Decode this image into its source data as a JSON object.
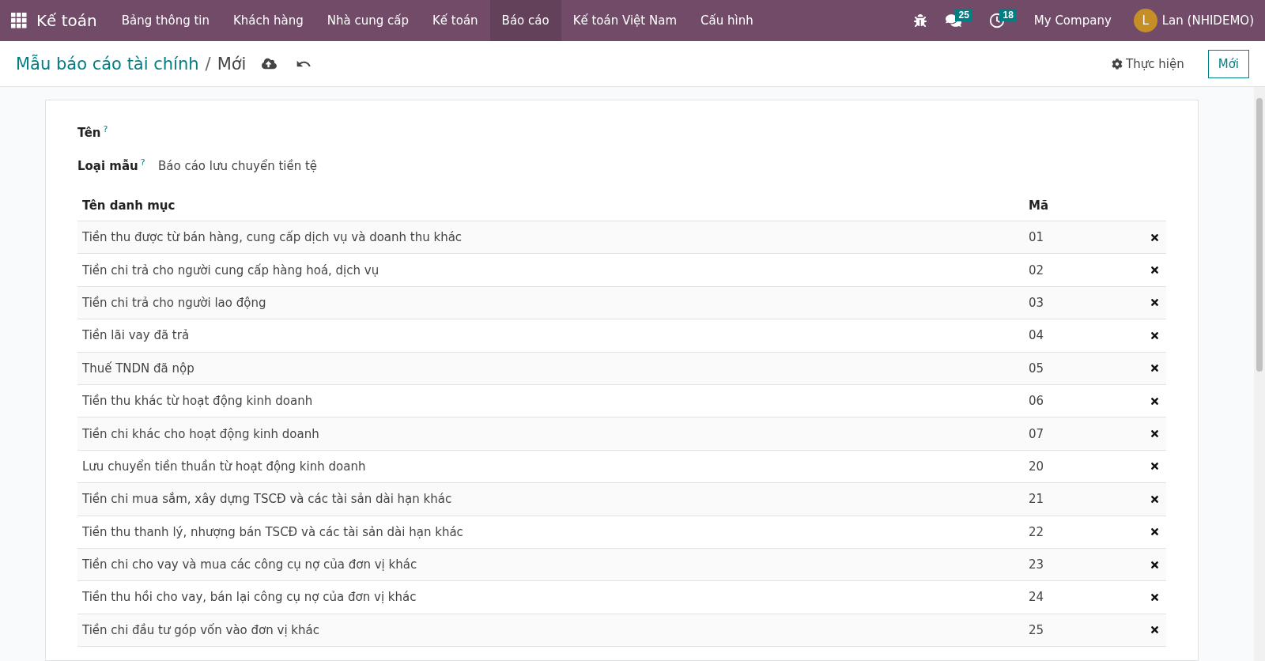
{
  "navbar": {
    "app_name": "Kế toán",
    "menu": [
      {
        "label": "Bảng thông tin",
        "selected": false
      },
      {
        "label": "Khách hàng",
        "selected": false
      },
      {
        "label": "Nhà cung cấp",
        "selected": false
      },
      {
        "label": "Kế toán",
        "selected": false
      },
      {
        "label": "Báo cáo",
        "selected": true
      },
      {
        "label": "Kế toán Việt Nam",
        "selected": false
      },
      {
        "label": "Cấu hình",
        "selected": false
      }
    ],
    "messages_count": "25",
    "activities_count": "18",
    "company": "My Company",
    "avatar_letter": "L",
    "user": "Lan (NHIDEMO)"
  },
  "control_panel": {
    "breadcrumb_parent": "Mẫu báo cáo tài chính",
    "breadcrumb_separator": "/",
    "breadcrumb_current": "Mới",
    "action_button": "Thực hiện",
    "new_button": "Mới"
  },
  "form": {
    "fields": [
      {
        "label": "Tên",
        "help": "?"
      },
      {
        "label": "Loại mẫu",
        "help": "?",
        "value": "Báo cáo lưu chuyển tiền tệ"
      }
    ],
    "table": {
      "columns": [
        "Tên danh mục",
        "Mã"
      ],
      "rows": [
        {
          "name": "Tiền thu được từ bán hàng, cung cấp dịch vụ và doanh thu khác",
          "code": "01"
        },
        {
          "name": "Tiền chi trả cho người cung cấp hàng hoá, dịch vụ",
          "code": "02"
        },
        {
          "name": "Tiền chi trả cho người lao động",
          "code": "03"
        },
        {
          "name": "Tiền lãi vay đã trả",
          "code": "04"
        },
        {
          "name": "Thuế TNDN đã nộp",
          "code": "05"
        },
        {
          "name": "Tiền thu khác từ hoạt động kinh doanh",
          "code": "06"
        },
        {
          "name": "Tiền chi khác cho hoạt động kinh doanh",
          "code": "07"
        },
        {
          "name": "Lưu chuyển tiền thuần từ hoạt động kinh doanh",
          "code": "20"
        },
        {
          "name": "Tiền chi mua sắm, xây dựng TSCĐ và các tài sản dài hạn khác",
          "code": "21"
        },
        {
          "name": "Tiền thu thanh lý, nhượng bán TSCĐ và các tài sản dài hạn khác",
          "code": "22"
        },
        {
          "name": "Tiền chi cho vay và mua các công cụ nợ của đơn vị khác",
          "code": "23"
        },
        {
          "name": "Tiền thu hồi cho vay, bán lại công cụ nợ của đơn vị khác",
          "code": "24"
        },
        {
          "name": "Tiền chi đầu tư góp vốn vào đơn vị khác",
          "code": "25"
        }
      ]
    }
  }
}
